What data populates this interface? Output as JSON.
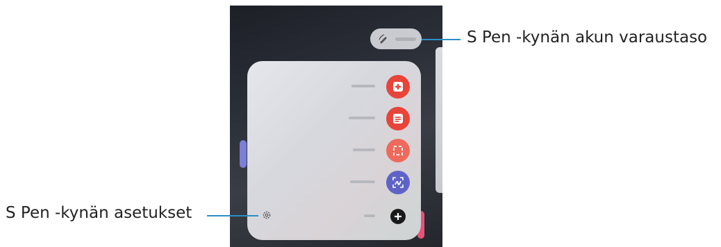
{
  "callouts": {
    "battery": "S Pen -kynän akun varaustaso",
    "settings": "S Pen -kynän asetukset"
  },
  "colors": {
    "create_note": "#e8443a",
    "view_all_notes": "#e8443a",
    "smart_select": "#ef6a5c",
    "screen_write": "#5f63c8",
    "add": "#1a1a1a",
    "callout_line": "#2a8fc6"
  },
  "menu": {
    "items": [
      {
        "icon": "create-note-icon"
      },
      {
        "icon": "view-all-notes-icon"
      },
      {
        "icon": "smart-select-icon"
      },
      {
        "icon": "screen-write-icon"
      },
      {
        "icon": "add-icon"
      }
    ]
  }
}
